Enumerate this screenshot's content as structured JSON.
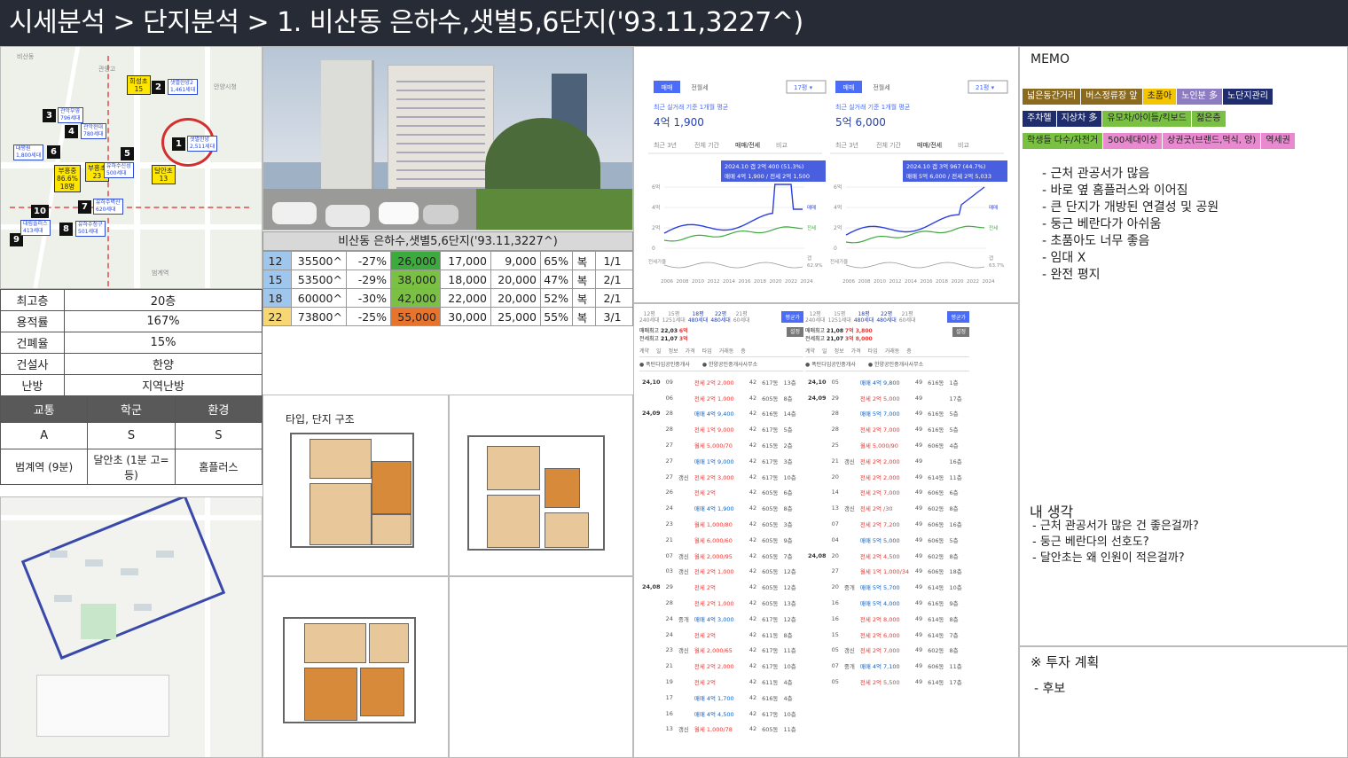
{
  "header": {
    "title": "시세분석 > 단지분석 > 1. 비산동 은하수,샛별5,6단지('93.11,3227^)"
  },
  "location_map": {
    "markers": [
      {
        "num": "1",
        "name": "샛별한양",
        "sub": "2,511세대"
      },
      {
        "num": "2",
        "name": "샛별한양2",
        "sub": "1,461세대"
      },
      {
        "num": "3",
        "name": "관악부영",
        "sub": "796세대"
      },
      {
        "num": "4",
        "name": "관악현대",
        "sub": "780세대"
      },
      {
        "num": "5",
        "name": "유하수신성",
        "sub": "500세대"
      },
      {
        "num": "6",
        "name": "대평원",
        "sub": "1,800세대"
      },
      {
        "num": "7",
        "name": "유하수벽산",
        "sub": "620세대"
      },
      {
        "num": "8",
        "name": "유하수청구",
        "sub": "501세대"
      },
      {
        "num": "9",
        "name": "",
        "sub": ""
      },
      {
        "num": "10",
        "name": "대림플러스",
        "sub": "413세대"
      }
    ],
    "schools": [
      {
        "name": "희성초",
        "value": "15"
      },
      {
        "name": "부흥중",
        "value": "86.6%\n18명"
      },
      {
        "name": "부흥초",
        "value": "23"
      },
      {
        "name": "달안초",
        "value": "13"
      }
    ]
  },
  "info_table": {
    "rows": [
      {
        "label": "최고층",
        "value": "20층"
      },
      {
        "label": "용적률",
        "value": "167%"
      },
      {
        "label": "건폐율",
        "value": "15%"
      },
      {
        "label": "건설사",
        "value": "한양"
      },
      {
        "label": "난방",
        "value": "지역난방"
      }
    ]
  },
  "rating_table": {
    "headers": [
      "교통",
      "학군",
      "환경"
    ],
    "grades": [
      "A",
      "S",
      "S"
    ],
    "notes": [
      "범계역 (9분)",
      "달안초 (1분 고=등)",
      "홈플러스"
    ]
  },
  "price_table": {
    "title": "비산동 은하수,샛별5,6단지('93.11,3227^)",
    "rows": [
      {
        "size": "12",
        "total": "35500^",
        "pct": "-27%",
        "price": "26,000",
        "jeonse": "17,000",
        "wolse": "9,000",
        "ratio": "65%",
        "type": "복",
        "count": "1/1",
        "size_color": "#9fc6ec",
        "price_color": "#3daa3d"
      },
      {
        "size": "15",
        "total": "53500^",
        "pct": "-29%",
        "price": "38,000",
        "jeonse": "18,000",
        "wolse": "20,000",
        "ratio": "47%",
        "type": "복",
        "count": "2/1",
        "size_color": "#9fc6ec",
        "price_color": "#7ac143"
      },
      {
        "size": "18",
        "total": "60000^",
        "pct": "-30%",
        "price": "42,000",
        "jeonse": "22,000",
        "wolse": "20,000",
        "ratio": "52%",
        "type": "복",
        "count": "2/1",
        "size_color": "#9fc6ec",
        "price_color": "#7ac143"
      },
      {
        "size": "22",
        "total": "73800^",
        "pct": "-25%",
        "price": "55,000",
        "jeonse": "30,000",
        "wolse": "25,000",
        "ratio": "55%",
        "type": "복",
        "count": "3/1",
        "size_color": "#f7d774",
        "price_color": "#e6742d"
      }
    ]
  },
  "floorplan": {
    "title": "타입, 단지 구조"
  },
  "price_charts": [
    {
      "tab_sale": "매매",
      "tab_rent": "전월세",
      "size_select": "17평",
      "caption": "최근 실거래 기준 1개월 평균",
      "avg_price": "4억 1,900",
      "period_tabs": [
        "최근 3년",
        "전체 기간",
        "매매/전세",
        "비교"
      ],
      "tooltip_line1": "2024.10  갭 2억 400 (51.3%)",
      "tooltip_line2": "매매 4억 1,900 / 전세 2억 1,500",
      "y_ticks": [
        "6억",
        "4억",
        "2억",
        "0"
      ],
      "x_ticks": [
        "2006",
        "2008",
        "2010",
        "2012",
        "2014",
        "2016",
        "2018",
        "2020",
        "2022",
        "2024"
      ],
      "right_labels": [
        "매매",
        "전세",
        "갭"
      ],
      "gap_label": "전세가율",
      "ratio_label": "62.9%"
    },
    {
      "tab_sale": "매매",
      "tab_rent": "전월세",
      "size_select": "21평",
      "caption": "최근 실거래 기준 1개월 평균",
      "avg_price": "5억 6,000",
      "period_tabs": [
        "최근 3년",
        "전체 기간",
        "매매/전세",
        "비교"
      ],
      "tooltip_line1": "2024.10  갭 3억 967 (44.7%)",
      "tooltip_line2": "매매 5억 6,000 / 전세 2억 5,033",
      "y_ticks": [
        "6억",
        "4억",
        "2억",
        "0"
      ],
      "x_ticks": [
        "2006",
        "2008",
        "2010",
        "2012",
        "2014",
        "2016",
        "2018",
        "2020",
        "2022",
        "2024"
      ],
      "right_labels": [
        "매매",
        "전세",
        "갭"
      ],
      "gap_label": "전세가율",
      "ratio_label": "63.7%"
    }
  ],
  "trade_lists": [
    {
      "size_tabs": [
        "12평",
        "15평",
        "18평",
        "22평",
        "21평"
      ],
      "size_subs": [
        "240세대",
        "1251세대",
        "480세대",
        "480세대",
        "60세대"
      ],
      "compare_btn": "평균가",
      "max_sale_label": "매매최고",
      "max_sale": "22,03",
      "max_sale_val": "6억",
      "max_rent_label": "전세최고",
      "max_rent": "21,07",
      "max_rent_val": "3억",
      "set_btn": "설정",
      "cols": [
        "계약",
        "일",
        "정보",
        "가격",
        "타입",
        "거래동",
        "층"
      ],
      "agents": [
        "폭탄다임공인중개사",
        "한양공인중개사사무소"
      ],
      "rows": [
        [
          "24,10",
          "09",
          "",
          "전세 2억 2,000",
          "42",
          "617동",
          "13층"
        ],
        [
          "",
          "06",
          "",
          "전세 2억 1,000",
          "42",
          "605동",
          "8층"
        ],
        [
          "24,09",
          "28",
          "",
          "매매 4억 9,400",
          "42",
          "616동",
          "14층"
        ],
        [
          "",
          "28",
          "",
          "전세 1억 9,000",
          "42",
          "617동",
          "5층"
        ],
        [
          "",
          "27",
          "",
          "월세 5,000/70",
          "42",
          "615동",
          "2층"
        ],
        [
          "",
          "27",
          "",
          "매매 1억 9,000",
          "42",
          "617동",
          "3층"
        ],
        [
          "",
          "27",
          "갱신",
          "전세 2억 3,000",
          "42",
          "617동",
          "10층"
        ],
        [
          "",
          "26",
          "",
          "전세 2억",
          "42",
          "605동",
          "6층"
        ],
        [
          "",
          "24",
          "",
          "매매 4억 1,900",
          "42",
          "605동",
          "8층"
        ],
        [
          "",
          "23",
          "",
          "월세 1,000/80",
          "42",
          "605동",
          "3층"
        ],
        [
          "",
          "21",
          "",
          "월세 6,000/60",
          "42",
          "605동",
          "9층"
        ],
        [
          "",
          "07",
          "갱신",
          "월세 2,000/95",
          "42",
          "605동",
          "7층"
        ],
        [
          "",
          "03",
          "갱신",
          "전세 2억 1,000",
          "42",
          "605동",
          "12층"
        ],
        [
          "24,08",
          "29",
          "",
          "전세 2억",
          "42",
          "605동",
          "12층"
        ],
        [
          "",
          "28",
          "",
          "전세 2억 1,000",
          "42",
          "605동",
          "13층"
        ],
        [
          "",
          "24",
          "중개",
          "매매 4억 3,000",
          "42",
          "617동",
          "12층"
        ],
        [
          "",
          "24",
          "",
          "전세 2억",
          "42",
          "611동",
          "8층"
        ],
        [
          "",
          "23",
          "갱신",
          "월세 2,000/65",
          "42",
          "617동",
          "11층"
        ],
        [
          "",
          "21",
          "",
          "전세 2억 2,000",
          "42",
          "617동",
          "10층"
        ],
        [
          "",
          "19",
          "",
          "전세 2억",
          "42",
          "611동",
          "4층"
        ],
        [
          "",
          "17",
          "",
          "매매 4억 1,700",
          "42",
          "616동",
          "4층"
        ],
        [
          "",
          "16",
          "",
          "매매 4억 4,500",
          "42",
          "617동",
          "10층"
        ],
        [
          "",
          "13",
          "갱신",
          "월세 1,000/78",
          "42",
          "605동",
          "11층"
        ]
      ]
    },
    {
      "size_tabs": [
        "12평",
        "15평",
        "18평",
        "22평",
        "21평"
      ],
      "size_subs": [
        "240세대",
        "1251세대",
        "480세대",
        "480세대",
        "60세대"
      ],
      "compare_btn": "평균가",
      "max_sale_label": "매매최고",
      "max_sale": "21,08",
      "max_sale_val": "7억 3,800",
      "max_rent_label": "전세최고",
      "max_rent": "21,07",
      "max_rent_val": "3억 8,000",
      "set_btn": "설정",
      "cols": [
        "계약",
        "일",
        "정보",
        "가격",
        "타입",
        "거래동",
        "층"
      ],
      "agents": [
        "폭탄다임공인중개사",
        "한양공인중개사사무소"
      ],
      "rows": [
        [
          "24,10",
          "05",
          "",
          "매매 4억 9,800",
          "49",
          "616동",
          "1층"
        ],
        [
          "24,09",
          "29",
          "",
          "전세 2억 5,000",
          "49",
          "",
          "17층"
        ],
        [
          "",
          "28",
          "",
          "매매 5억 7,000",
          "49",
          "616동",
          "5층"
        ],
        [
          "",
          "28",
          "",
          "전세 2억 7,000",
          "49",
          "616동",
          "5층"
        ],
        [
          "",
          "25",
          "",
          "월세 5,000/90",
          "49",
          "606동",
          "4층"
        ],
        [
          "",
          "21",
          "갱신",
          "전세 2억 2,000",
          "49",
          "",
          "16층"
        ],
        [
          "",
          "20",
          "",
          "전세 2억 2,000",
          "49",
          "614동",
          "11층"
        ],
        [
          "",
          "14",
          "",
          "전세 2억 7,000",
          "49",
          "606동",
          "6층"
        ],
        [
          "",
          "13",
          "갱신",
          "전세 2억 /30",
          "49",
          "602동",
          "8층"
        ],
        [
          "",
          "07",
          "",
          "전세 2억 7,200",
          "49",
          "606동",
          "16층"
        ],
        [
          "",
          "04",
          "",
          "매매 5억 5,000",
          "49",
          "606동",
          "5층"
        ],
        [
          "24,08",
          "20",
          "",
          "전세 2억 4,500",
          "49",
          "602동",
          "8층"
        ],
        [
          "",
          "27",
          "",
          "월세 1억 1,000/34",
          "49",
          "606동",
          "18층"
        ],
        [
          "",
          "20",
          "중개",
          "매매 5억 5,700",
          "49",
          "614동",
          "10층"
        ],
        [
          "",
          "16",
          "",
          "매매 5억 4,000",
          "49",
          "616동",
          "9층"
        ],
        [
          "",
          "16",
          "",
          "전세 2억 8,000",
          "49",
          "614동",
          "8층"
        ],
        [
          "",
          "15",
          "",
          "전세 2억 6,000",
          "49",
          "614동",
          "7층"
        ],
        [
          "",
          "05",
          "갱신",
          "전세 2억 7,000",
          "49",
          "602동",
          "8층"
        ],
        [
          "",
          "07",
          "중개",
          "매매 4억 7,100",
          "49",
          "606동",
          "11층"
        ],
        [
          "",
          "05",
          "",
          "전세 2억 5,500",
          "49",
          "614동",
          "17층"
        ]
      ]
    }
  ],
  "memo": {
    "title": "MEMO",
    "tags_row1": [
      {
        "label": "넓은동간거리",
        "bg": "#8a6a1f",
        "fg": "#fff"
      },
      {
        "label": "버스정류장 앞",
        "bg": "#8a6a1f",
        "fg": "#fff"
      },
      {
        "label": "초품아",
        "bg": "#f5c400",
        "fg": "#222"
      },
      {
        "label": "노인분 多",
        "bg": "#8e7cc3",
        "fg": "#fff"
      },
      {
        "label": "노단지관리",
        "bg": "#1f2d6e",
        "fg": "#fff"
      }
    ],
    "tags_row2": [
      {
        "label": "주차헬",
        "bg": "#1f2d6e",
        "fg": "#fff"
      },
      {
        "label": "지상차 多",
        "bg": "#1f2d6e",
        "fg": "#fff"
      },
      {
        "label": "유모차/아이들/킥보드",
        "bg": "#7ac143",
        "fg": "#222"
      },
      {
        "label": "젊은층",
        "bg": "#7ac143",
        "fg": "#222"
      }
    ],
    "tags_row3": [
      {
        "label": "학생들 다수/자전거",
        "bg": "#7ac143",
        "fg": "#222"
      },
      {
        "label": "500세대이상",
        "bg": "#e98ad0",
        "fg": "#222"
      },
      {
        "label": "상권굿(브랜드,먹식, 양)",
        "bg": "#e98ad0",
        "fg": "#222"
      },
      {
        "label": "역세권",
        "bg": "#e98ad0",
        "fg": "#222"
      }
    ],
    "notes": [
      "- 근처 관공서가 많음",
      "- 바로 옆 홈플러스와 이어짐",
      "- 큰 단지가 개방된 연결성 및 공원",
      "- 둥근 베란다가 아쉬움",
      "- 초품아도 너무 좋음",
      "- 임대 X",
      "- 완전 평지"
    ],
    "thought_title": "내 생각",
    "thoughts": [
      "- 근처 관공서가 많은 건 좋은걸까?",
      "- 둥근 베란다의 선호도?",
      "- 달안초는 왜 인원이 적은걸까?"
    ],
    "plan_title": "※  투자 계획",
    "plan": "- 후보"
  }
}
